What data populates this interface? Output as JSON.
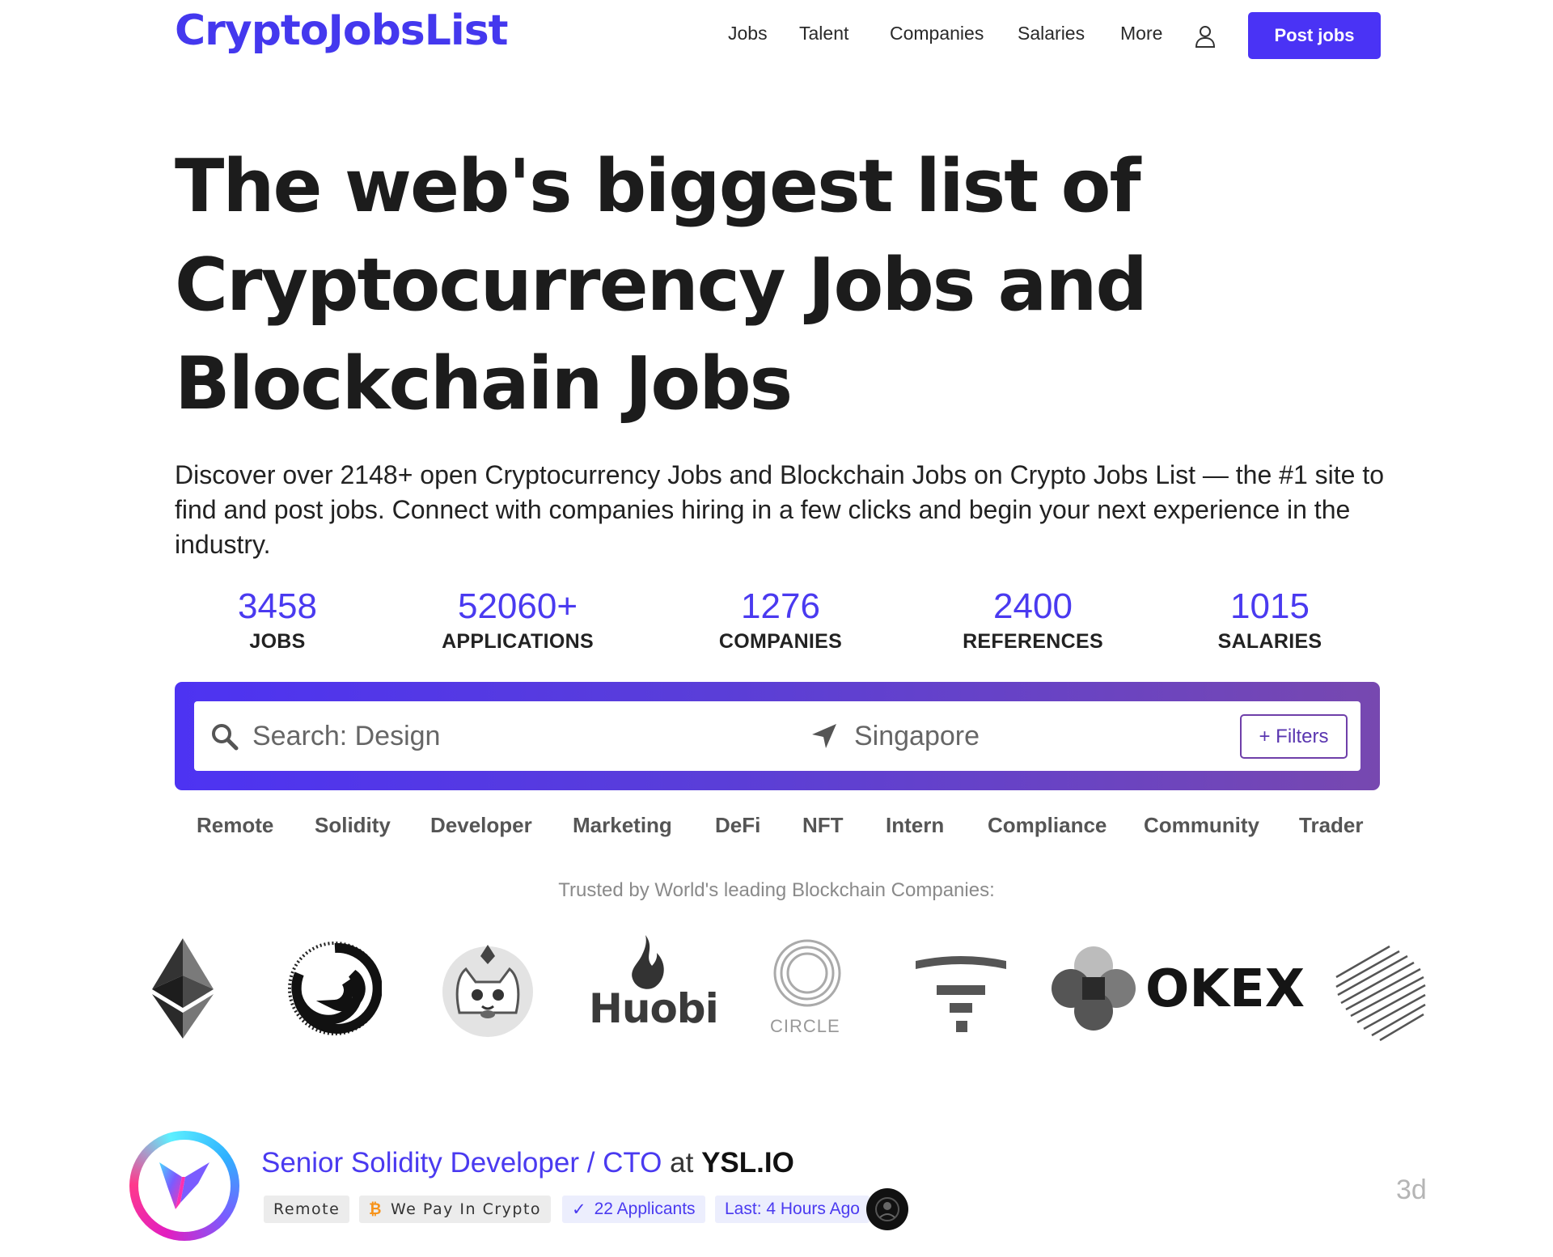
{
  "header": {
    "logo": "CryptoJobsList",
    "nav": [
      "Jobs",
      "Talent",
      "Companies",
      "Salaries",
      "More"
    ],
    "post_jobs": "Post jobs"
  },
  "hero": {
    "title_line1": "The web's biggest list of",
    "title_line2": "Cryptocurrency Jobs and",
    "title_line3": "Blockchain Jobs",
    "description": "Discover over 2148+ open Cryptocurrency Jobs and Blockchain Jobs on Crypto Jobs List — the #1 site to find and post jobs. Connect with companies hiring in a few clicks and begin your next experience in the industry."
  },
  "stats": [
    {
      "value": "3458",
      "label": "JOBS"
    },
    {
      "value": "52060+",
      "label": "APPLICATIONS"
    },
    {
      "value": "1276",
      "label": "COMPANIES"
    },
    {
      "value": "2400",
      "label": "REFERENCES"
    },
    {
      "value": "1015",
      "label": "SALARIES"
    }
  ],
  "search": {
    "query_placeholder": "Search: Design",
    "location_placeholder": "Singapore",
    "filters_label": "+ Filters"
  },
  "tags": [
    "Remote",
    "Solidity",
    "Developer",
    "Marketing",
    "DeFi",
    "NFT",
    "Intern",
    "Compliance",
    "Community",
    "Trader"
  ],
  "trusted_text": "Trusted by World's leading Blockchain Companies:",
  "brands": {
    "huobi": "Huobi",
    "circle": "CIRCLE",
    "okex": "OKEX"
  },
  "job": {
    "role": "Senior Solidity Developer / CTO",
    "at": "at",
    "company": "YSL.IO",
    "badges": {
      "remote": "Remote",
      "crypto": "We Pay In Crypto",
      "applicants": "22 Applicants",
      "last": "Last: 4 Hours Ago"
    },
    "age": "3d"
  },
  "colors": {
    "accent": "#4a33f5",
    "accent_text": "#4a3af0"
  }
}
